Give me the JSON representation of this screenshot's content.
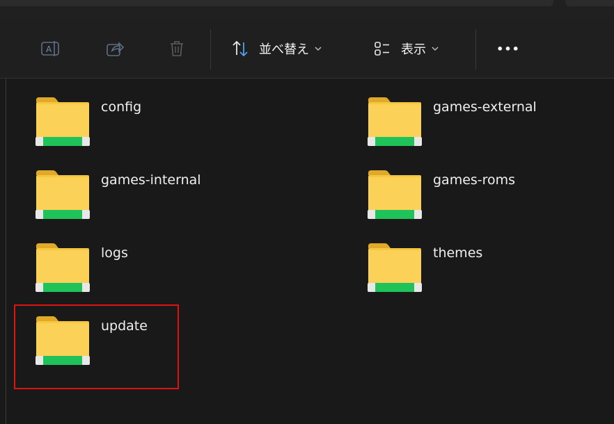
{
  "toolbar": {
    "rename_icon": "rename-icon",
    "share_icon": "share-icon",
    "delete_icon": "trash-icon",
    "sort_label": "並べ替え",
    "sort_icon": "sort-icon",
    "view_label": "表示",
    "view_icon": "view-list-icon",
    "more_label": "•••"
  },
  "folders": [
    {
      "name": "config"
    },
    {
      "name": "games-external"
    },
    {
      "name": "games-internal"
    },
    {
      "name": "games-roms"
    },
    {
      "name": "logs"
    },
    {
      "name": "themes"
    },
    {
      "name": "update"
    }
  ],
  "colors": {
    "background": "#191919",
    "folder_yellow": "#f7c83e",
    "folder_green": "#1fc35a",
    "highlight": "#e11212"
  }
}
